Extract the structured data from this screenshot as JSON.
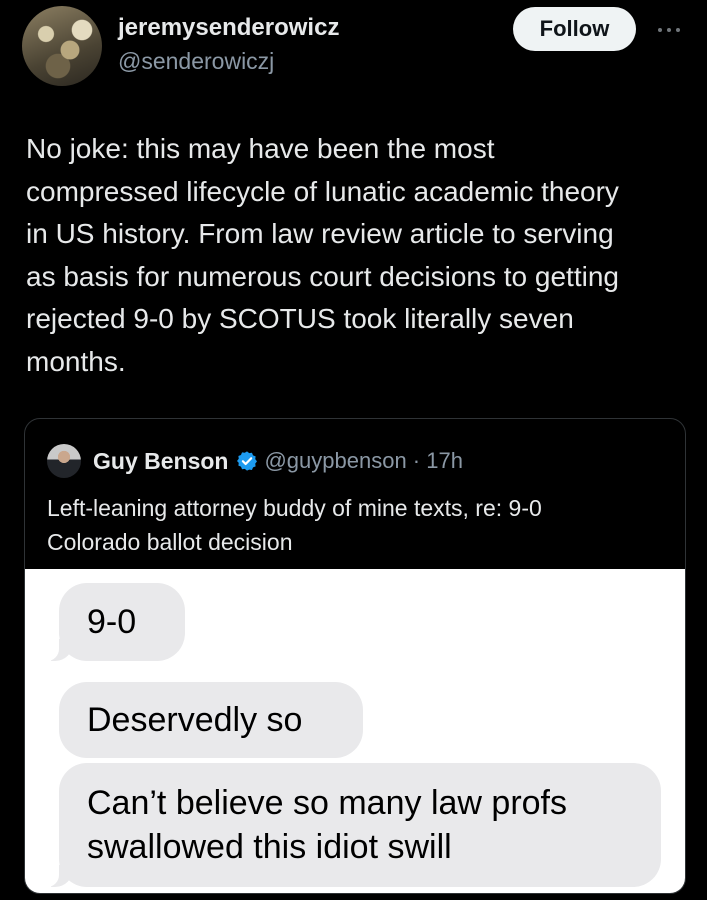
{
  "post": {
    "author": {
      "display_name": "jeremysenderowicz",
      "handle": "@senderowiczj"
    },
    "follow_label": "Follow",
    "more_icon": "more-horizontal-icon",
    "text_lines": [
      "No joke: this may have been the most",
      "compressed lifecycle of lunatic academic theory",
      "in US history. From law review article to serving",
      "as basis for numerous court decisions to getting",
      "rejected 9-0 by SCOTUS took literally seven",
      "months."
    ]
  },
  "quote": {
    "author": {
      "display_name": "Guy Benson",
      "verified_icon": "verified-badge-icon",
      "handle_time": "@guypbenson · 17h"
    },
    "text_lines": [
      "Left-leaning attorney buddy of mine texts, re: 9-0",
      "Colorado ballot decision"
    ],
    "messages": [
      {
        "lines": [
          "9-0"
        ]
      },
      {
        "lines": [
          "Deservedly so"
        ]
      },
      {
        "lines": [
          "Can’t believe so many law profs",
          "swallowed this idiot swill"
        ]
      }
    ]
  },
  "colors": {
    "background": "#000000",
    "text": "#e7e9ea",
    "muted": "#8b98a5",
    "verified": "#1d9bf0",
    "bubble": "#e9e9eb"
  }
}
